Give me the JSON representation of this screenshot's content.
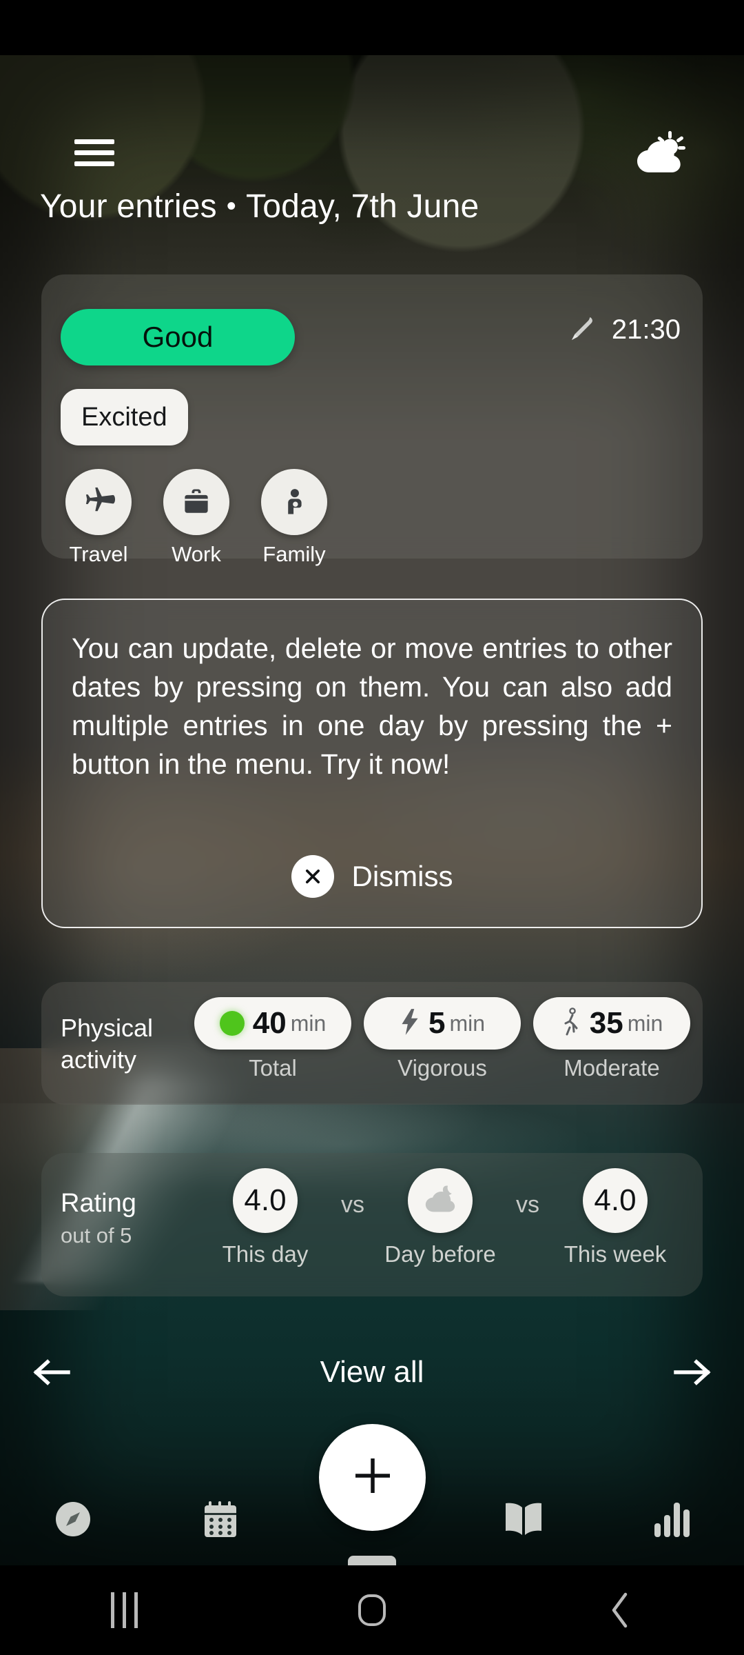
{
  "header": {
    "menu_icon": "hamburger-menu-icon",
    "weather_icon": "partly-cloudy-icon",
    "title_primary": "Your entries",
    "separator": "•",
    "title_date": "Today, 7th June"
  },
  "entry": {
    "mood_label": "Good",
    "mood_color": "#0ed68a",
    "edit_icon": "pencil-icon",
    "time": "21:30",
    "feeling_label": "Excited",
    "tags": [
      {
        "label": "Travel",
        "icon": "airplane-icon"
      },
      {
        "label": "Work",
        "icon": "briefcase-icon"
      },
      {
        "label": "Family",
        "icon": "family-icon"
      }
    ]
  },
  "info": {
    "text": "You can update, delete or move entries to other dates by pressing on them. You can also add multiple entries in one day by pressing the + button in the menu. Try it now!",
    "dismiss_icon": "close-icon",
    "dismiss_label": "Dismiss"
  },
  "activity": {
    "title": "Physical activity",
    "items": [
      {
        "value": "40",
        "unit": "min",
        "caption": "Total",
        "icon": "green-dot-icon",
        "dot_color": "#4fc51c"
      },
      {
        "value": "5",
        "unit": "min",
        "caption": "Vigorous",
        "icon": "lightning-bolt-icon"
      },
      {
        "value": "35",
        "unit": "min",
        "caption": "Moderate",
        "icon": "walking-person-icon"
      }
    ]
  },
  "rating": {
    "title": "Rating",
    "subtitle": "out of 5",
    "vs_label": "vs",
    "items": [
      {
        "value": "4.0",
        "caption": "This day",
        "icon": ""
      },
      {
        "value": "",
        "caption": "Day before",
        "icon": "cloudy-night-icon"
      },
      {
        "value": "4.0",
        "caption": "This week",
        "icon": ""
      }
    ]
  },
  "pager": {
    "prev_icon": "arrow-left-icon",
    "view_all_label": "View all",
    "next_icon": "arrow-right-icon"
  },
  "bottom_nav": {
    "items": [
      {
        "icon": "compass-icon"
      },
      {
        "icon": "calendar-icon"
      },
      {
        "icon": "book-icon"
      },
      {
        "icon": "bar-chart-icon"
      }
    ],
    "fab_icon": "plus-icon"
  },
  "system_nav": {
    "recents_icon": "recents-icon",
    "home_icon": "home-icon",
    "back_icon": "back-icon"
  }
}
